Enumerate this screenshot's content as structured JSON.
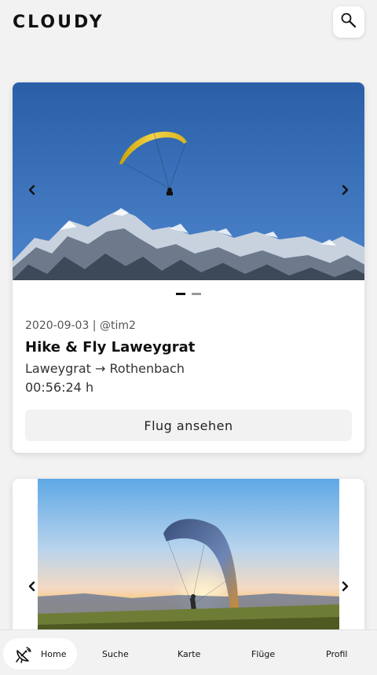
{
  "app": {
    "title": "CLOUDY"
  },
  "header": {
    "search_icon": "search-icon"
  },
  "colors": {
    "background": "#f2f2f2",
    "card": "#ffffff",
    "text": "#111111",
    "muted": "#555555"
  },
  "feed": [
    {
      "date": "2020-09-03",
      "user": "@tim2",
      "meta": "2020-09-03 | @tim2",
      "title": "Hike & Fly Laweygrat",
      "route": "Laweygrat → Rothenbach",
      "duration": "00:56:24 h",
      "button_label": "Flug ansehen",
      "image": "paraglider-over-snowy-mountains",
      "slide_count": 2,
      "active_slide": 1
    },
    {
      "image": "paraglider-launch-at-sunset"
    }
  ],
  "bottom_nav": {
    "items": [
      {
        "label": "Home",
        "icon": "satellite-dish-icon",
        "active": true
      },
      {
        "label": "Suche"
      },
      {
        "label": "Karte"
      },
      {
        "label": "Flüge"
      },
      {
        "label": "Profil"
      }
    ]
  }
}
